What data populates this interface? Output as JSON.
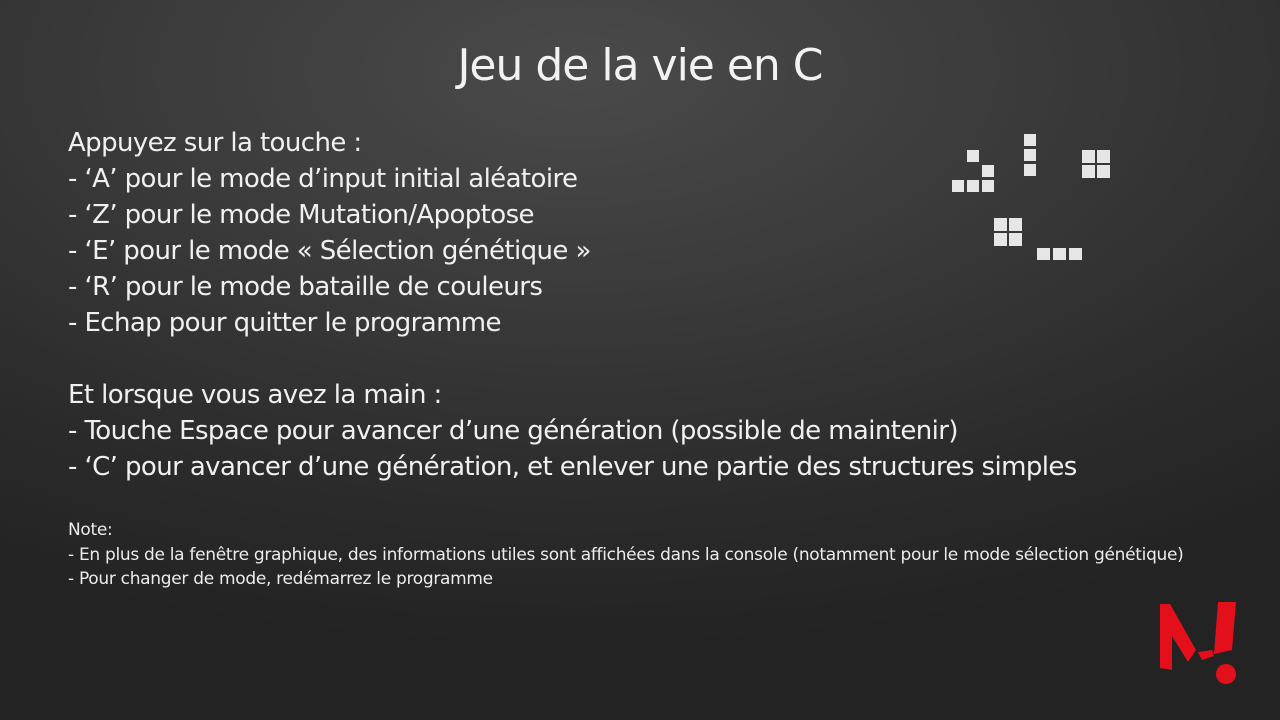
{
  "slide": {
    "title": "Jeu de la vie en C"
  },
  "keys": {
    "heading": "Appuyez sur la touche :",
    "items": [
      "- ‘A’ pour le mode d’input initial aléatoire",
      "- ‘Z’ pour le mode Mutation/Apoptose",
      "- ‘E’ pour le mode « Sélection génétique »",
      "- ‘R’ pour le mode bataille de couleurs",
      "- Echap pour quitter le programme"
    ]
  },
  "ingame": {
    "heading": "Et lorsque vous avez la main :",
    "items": [
      "- Touche Espace pour avancer d’une génération (possible de maintenir)",
      "- ‘C’ pour avancer d’une génération, et enlever une partie des structures simples"
    ]
  },
  "note": {
    "heading": "Note:",
    "items": [
      "- En plus de la fenêtre graphique, des informations utiles sont affichées dans la console (notamment pour le mode sélection génétique)",
      "- Pour changer de mode, redémarrez le programme"
    ]
  },
  "colors": {
    "cell": "#e6e6e6",
    "logo": "#e3101c"
  },
  "icons": {
    "life_patterns": "game-of-life-patterns-icon",
    "logo": "brand-logo-icon"
  }
}
